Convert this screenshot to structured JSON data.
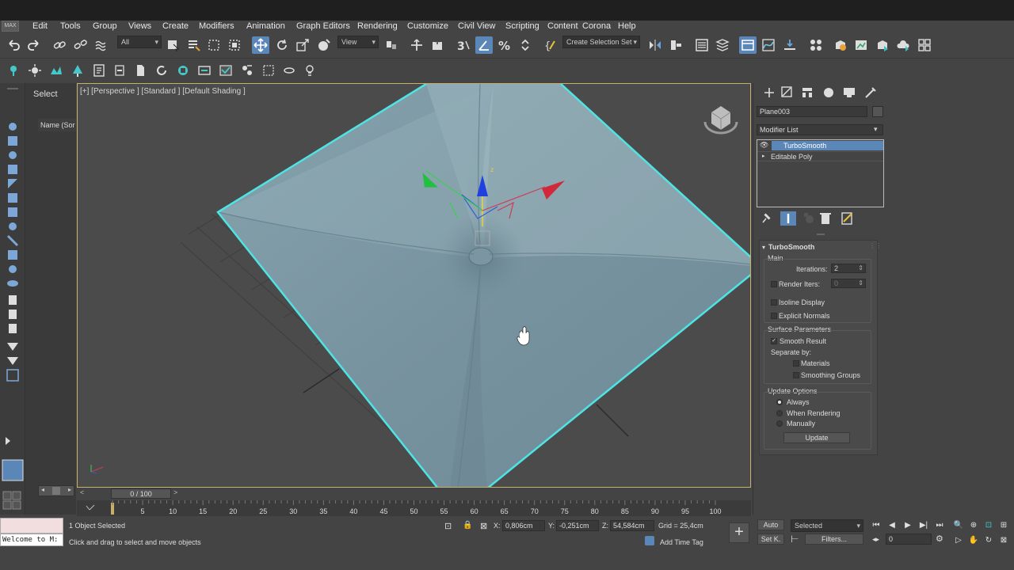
{
  "app": {
    "icon_text": "MAX"
  },
  "menu": [
    "Edit",
    "Tools",
    "Group",
    "Views",
    "Create",
    "Modifiers",
    "Animation",
    "Graph Editors",
    "Rendering",
    "Customize",
    "Civil View",
    "Scripting",
    "Content",
    "Corona",
    "Help"
  ],
  "toolbar": {
    "selection_filter": "All",
    "reference_coord": "View",
    "named_selection_set": "Create Selection Set"
  },
  "scene_explorer": {
    "tab_label": "Select",
    "column_header": "Name (Sor"
  },
  "viewport": {
    "label": "[+] [Perspective ] [Standard ] [Default Shading ]"
  },
  "time_slider": {
    "value": "0 / 100",
    "prev": "<",
    "next": ">"
  },
  "trackbar": {
    "ticks": [
      "0",
      "5",
      "10",
      "15",
      "20",
      "25",
      "30",
      "35",
      "40",
      "45",
      "50",
      "55",
      "60",
      "65",
      "70",
      "75",
      "80",
      "85",
      "90",
      "95",
      "100"
    ]
  },
  "command_panel": {
    "object_name": "Plane003",
    "modifier_list_label": "Modifier List",
    "stack": [
      {
        "label": "TurboSmooth",
        "selected": true
      },
      {
        "label": "Editable Poly",
        "selected": false
      }
    ],
    "rollout": {
      "title": "TurboSmooth",
      "main_label": "Main",
      "iterations_label": "Iterations:",
      "iterations_value": "2",
      "render_iters_label": "Render Iters:",
      "render_iters_value": "0",
      "isoline_display": "Isoline Display",
      "explicit_normals": "Explicit Normals",
      "surface_params": "Surface Parameters",
      "smooth_result": "Smooth Result",
      "separate_by": "Separate by:",
      "materials": "Materials",
      "smoothing_groups": "Smoothing Groups",
      "update_options": "Update Options",
      "always": "Always",
      "when_rendering": "When Rendering",
      "manually": "Manually",
      "update_button": "Update"
    }
  },
  "status": {
    "maxscript": "Welcome to M:",
    "selected_count": "1 Object Selected",
    "prompt": "Click and drag to select and move objects",
    "x_label": "X:",
    "x_value": "0,806cm",
    "y_label": "Y:",
    "y_value": "-0,251cm",
    "z_label": "Z:",
    "z_value": "54,584cm",
    "grid": "Grid = 25,4cm",
    "add_time_tag": "Add Time Tag",
    "auto_key": "Auto",
    "set_key": "Set K.",
    "key_filter": "Selected",
    "filters": "Filters...",
    "frame": "0"
  },
  "colors": {
    "selection_highlight": "#4fe3e3",
    "mesh": "#7e9ba6",
    "active_button": "#5b87b8",
    "viewport_border": "#c6b06a"
  }
}
